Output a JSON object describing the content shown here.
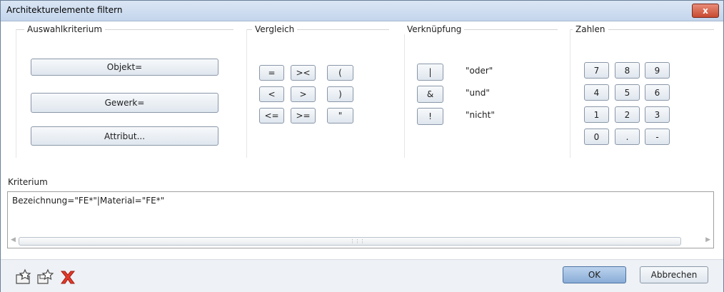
{
  "window": {
    "title": "Architekturelemente filtern",
    "close_label": "x"
  },
  "auswahl": {
    "label": "Auswahlkriterium",
    "buttons": [
      "Objekt=",
      "Gewerk=",
      "Attribut..."
    ]
  },
  "vergleich": {
    "label": "Vergleich",
    "buttons": [
      "=",
      "><",
      "(",
      "<",
      ">",
      ")",
      "<=",
      ">=",
      "\""
    ]
  },
  "verknuepfung": {
    "label": "Verknüpfung",
    "ops": [
      {
        "symbol": "|",
        "desc": "\"oder\""
      },
      {
        "symbol": "&",
        "desc": "\"und\""
      },
      {
        "symbol": "!",
        "desc": "\"nicht\""
      }
    ]
  },
  "zahlen": {
    "label": "Zahlen",
    "buttons": [
      "7",
      "8",
      "9",
      "4",
      "5",
      "6",
      "1",
      "2",
      "3",
      "0",
      ".",
      "-"
    ]
  },
  "kriterium": {
    "label": "Kriterium",
    "value": "Bezeichnung=\"FE*\"|Material=\"FE*\""
  },
  "footer": {
    "icons": [
      "open-favorite-icon",
      "save-favorite-icon",
      "delete-icon"
    ],
    "ok_label": "OK",
    "cancel_label": "Abbrechen"
  }
}
